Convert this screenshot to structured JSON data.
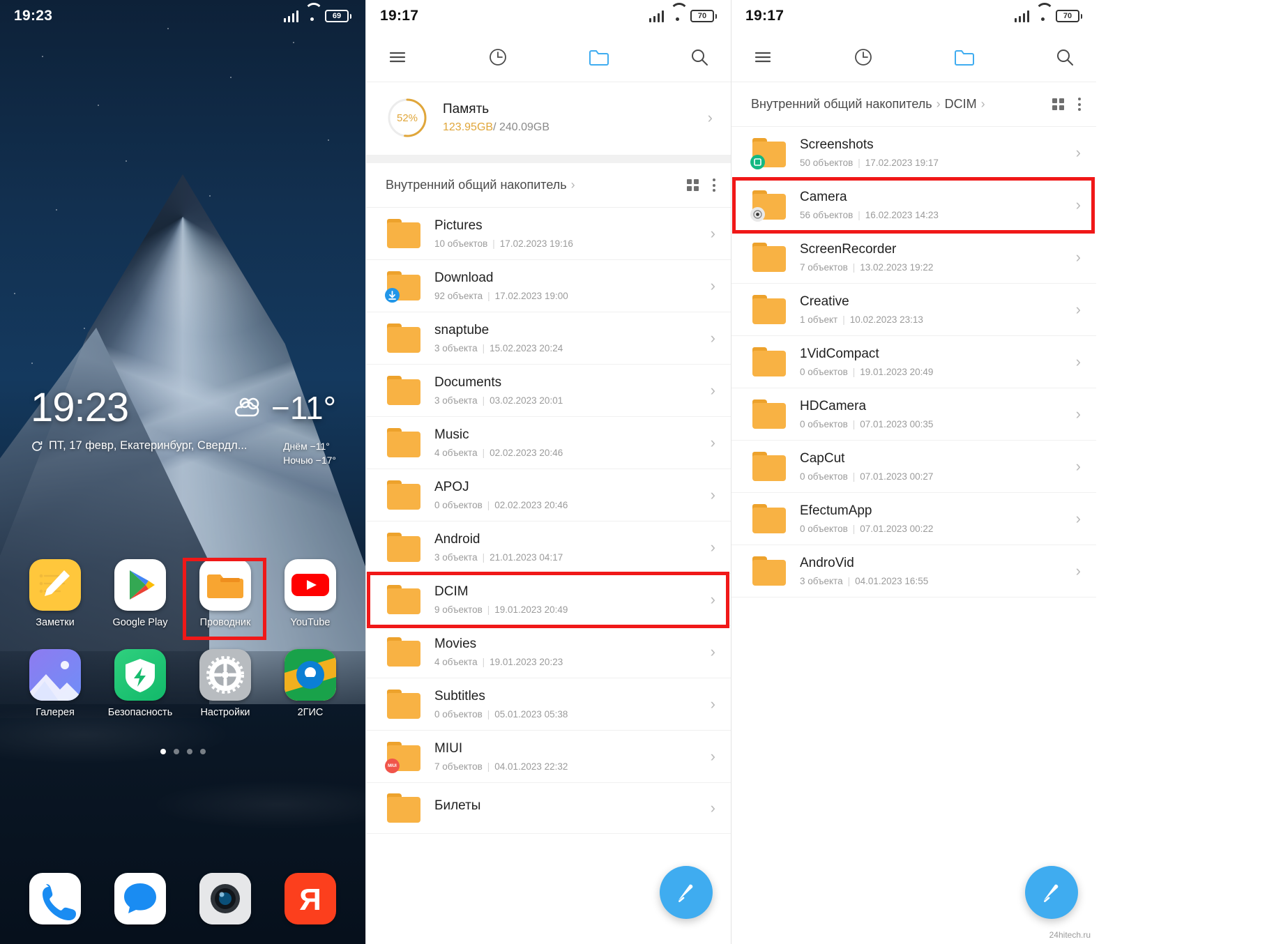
{
  "home": {
    "status": {
      "time": "19:23",
      "battery": "69"
    },
    "widget": {
      "time": "19:23",
      "temp": "−11°",
      "date": "ПТ, 17 февр, Екатеринбург, Свердл...",
      "day_forecast": "Днём −11°",
      "night_forecast": "Ночью −17°"
    },
    "apps": [
      {
        "label": "Заметки",
        "icon": "notes-icon"
      },
      {
        "label": "Google Play",
        "icon": "google-play-icon"
      },
      {
        "label": "Проводник",
        "icon": "file-explorer-icon"
      },
      {
        "label": "YouTube",
        "icon": "youtube-icon"
      },
      {
        "label": "Галерея",
        "icon": "gallery-icon"
      },
      {
        "label": "Безопасность",
        "icon": "security-icon"
      },
      {
        "label": "Настройки",
        "icon": "settings-gear-icon"
      },
      {
        "label": "2ГИС",
        "icon": "2gis-map-icon"
      }
    ],
    "dock": [
      {
        "label": "",
        "icon": "phone-icon"
      },
      {
        "label": "",
        "icon": "messages-icon"
      },
      {
        "label": "",
        "icon": "camera-icon"
      },
      {
        "label": "",
        "icon": "yandex-icon"
      }
    ],
    "page_dots": 4,
    "active_dot": 0,
    "highlight": "Проводник"
  },
  "fm_root": {
    "status": {
      "time": "19:17",
      "battery": "70"
    },
    "toolbar": {
      "menu": "menu-icon",
      "recent": "clock-icon",
      "folder": "folder-icon",
      "search": "search-icon"
    },
    "memory": {
      "percent": "52%",
      "percent_value": 52,
      "title": "Память",
      "used": "123.95GB",
      "total": "/ 240.09GB"
    },
    "breadcrumb": [
      "Внутренний общий накопитель"
    ],
    "files": [
      {
        "name": "Pictures",
        "count": "10 объектов",
        "date": "17.02.2023 19:16",
        "badge": ""
      },
      {
        "name": "Download",
        "count": "92 объекта",
        "date": "17.02.2023 19:00",
        "badge": "download"
      },
      {
        "name": "snaptube",
        "count": "3 объекта",
        "date": "15.02.2023 20:24",
        "badge": ""
      },
      {
        "name": "Documents",
        "count": "3 объекта",
        "date": "03.02.2023 20:01",
        "badge": ""
      },
      {
        "name": "Music",
        "count": "4 объекта",
        "date": "02.02.2023 20:46",
        "badge": ""
      },
      {
        "name": "APOJ",
        "count": "0 объектов",
        "date": "02.02.2023 20:46",
        "badge": ""
      },
      {
        "name": "Android",
        "count": "3 объекта",
        "date": "21.01.2023 04:17",
        "badge": ""
      },
      {
        "name": "DCIM",
        "count": "9 объектов",
        "date": "19.01.2023 20:49",
        "badge": "",
        "highlight": true
      },
      {
        "name": "Movies",
        "count": "4 объекта",
        "date": "19.01.2023 20:23",
        "badge": ""
      },
      {
        "name": "Subtitles",
        "count": "0 объектов",
        "date": "05.01.2023 05:38",
        "badge": ""
      },
      {
        "name": "MIUI",
        "count": "7 объектов",
        "date": "04.01.2023 22:32",
        "badge": "miui"
      },
      {
        "name": "Билеты",
        "count": "",
        "date": "",
        "badge": ""
      }
    ]
  },
  "fm_dcim": {
    "status": {
      "time": "19:17",
      "battery": "70"
    },
    "toolbar": {
      "menu": "menu-icon",
      "recent": "clock-icon",
      "folder": "folder-icon",
      "search": "search-icon"
    },
    "breadcrumb": [
      "Внутренний общий накопитель",
      "DCIM"
    ],
    "files": [
      {
        "name": "Screenshots",
        "count": "50 объектов",
        "date": "17.02.2023 19:17",
        "badge": "screenshot"
      },
      {
        "name": "Camera",
        "count": "56 объектов",
        "date": "16.02.2023 14:23",
        "badge": "camera",
        "highlight": true
      },
      {
        "name": "ScreenRecorder",
        "count": "7 объектов",
        "date": "13.02.2023 19:22",
        "badge": ""
      },
      {
        "name": "Creative",
        "count": "1 объект",
        "date": "10.02.2023 23:13",
        "badge": ""
      },
      {
        "name": "1VidCompact",
        "count": "0 объектов",
        "date": "19.01.2023 20:49",
        "badge": ""
      },
      {
        "name": "HDCamera",
        "count": "0 объектов",
        "date": "07.01.2023 00:35",
        "badge": ""
      },
      {
        "name": "CapCut",
        "count": "0 объектов",
        "date": "07.01.2023 00:27",
        "badge": ""
      },
      {
        "name": "EfectumApp",
        "count": "0 объектов",
        "date": "07.01.2023 00:22",
        "badge": ""
      },
      {
        "name": "AndroVid",
        "count": "3 объекта",
        "date": "04.01.2023 16:55",
        "badge": ""
      }
    ],
    "watermark": "24hitech.ru"
  },
  "colors": {
    "accent_blue": "#3facf0",
    "folder": "#f8b244",
    "highlight_red": "#f01818",
    "memory_gold": "#e0a63a"
  }
}
